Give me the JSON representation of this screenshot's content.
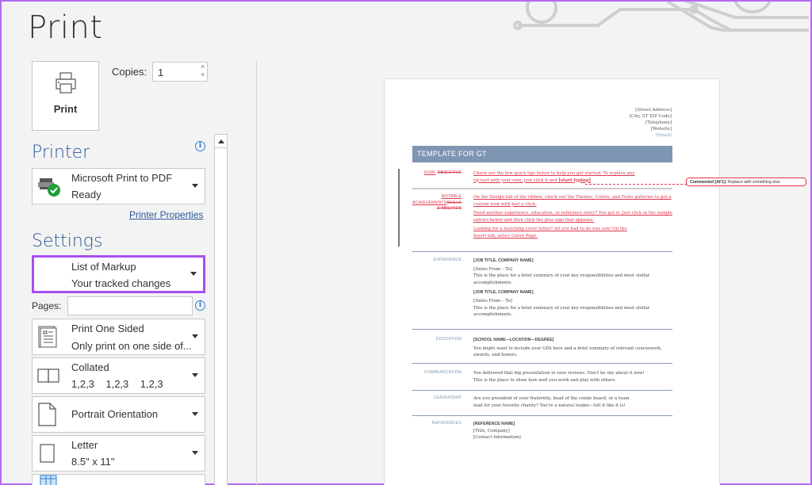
{
  "header": {
    "title": "Print"
  },
  "print_button": {
    "label": "Print",
    "icon": "printer-icon"
  },
  "copies": {
    "label": "Copies:",
    "value": "1"
  },
  "printer": {
    "section_title": "Printer",
    "name": "Microsoft Print to PDF",
    "status": "Ready",
    "properties_link": "Printer Properties"
  },
  "settings": {
    "section_title": "Settings",
    "what_to_print": {
      "line1": "List of Markup",
      "line2": "Your tracked changes"
    },
    "pages": {
      "label": "Pages:",
      "value": ""
    },
    "sides": {
      "line1": "Print One Sided",
      "line2": "Only print on one side of..."
    },
    "collation": {
      "line1": "Collated",
      "line2": "1,2,3    1,2,3    1,2,3"
    },
    "orientation": {
      "line1": "Portrait Orientation"
    },
    "paper": {
      "line1": "Letter",
      "line2": "8.5\" x 11\""
    }
  },
  "colors": {
    "accent": "#2b579a",
    "highlight": "#a64ff0",
    "revision": "#e0364e",
    "banner": "#7f96b2"
  },
  "preview": {
    "address": [
      "[Street Address]",
      "[City, ST ZIP Code]",
      "[Telephone]",
      "[Website]",
      "[Email]"
    ],
    "banner_title": "TEMPLATE FOR GT",
    "goal": {
      "label_ins": "GOAL",
      "label_del": "OBJECTIVE",
      "text1": "Check out the few quick tips below to help you get started. To replace any",
      "text2": "tip text with your own, just click it and ",
      "text2_bold": "[start typing]"
    },
    "notable": {
      "label1": "NOTABLE",
      "label2_ins": "ACHIEVEMENTS",
      "label2_del": "SKILLS",
      "label3_del": "& ABILITIES",
      "p1": "On the Design tab of the ribbon, check out the Themes, Colors, and Fonts galleries to get a custom look with just a click.",
      "p2": "Need another experience, education, or reference entry? You got it. Just click in the sample entries below and then click the plus sign that appears.",
      "p3": "Looking for a matching cover letter? All you had to do was ask! On the Insert tab, select Cover Page."
    },
    "experience": {
      "label": "EXPERIENCE",
      "jobs": [
        {
          "title": "[JOB TITLE, COMPANY NAME]",
          "dates": "[Dates From – To]",
          "desc": "This is the place for a brief summary of your key responsibilities and most stellar accomplishments."
        },
        {
          "title": "[JOB TITLE, COMPANY NAME]",
          "dates": "[Dates From – To]",
          "desc": "This is the place for a brief summary of your key responsibilities and most stellar accomplishments."
        }
      ]
    },
    "education": {
      "label": "EDUCATION",
      "title": "[SCHOOL NAME—LOCATION—DEGREE]",
      "desc": "You might want to include your GPA here and a brief summary of relevant coursework, awards, and honors."
    },
    "communication": {
      "label": "COMMUNICATION",
      "desc": "You delivered that big presentation to rave reviews. Don't be shy about it now! This is the place to show how well you work and play with others."
    },
    "leadership": {
      "label": "LEADERSHIP",
      "desc": "Are you president of your fraternity, head of the condo board, or a team lead for your favorite charity? You're a natural leader—tell it like it is!"
    },
    "references": {
      "label": "REFERENCES",
      "name": "[REFERENCE NAME]",
      "line2": "[Title, Company]",
      "line3": "[Contact Information]"
    },
    "comment": {
      "author": "Commented [AF1]:",
      "text": " Replace with something else"
    }
  }
}
